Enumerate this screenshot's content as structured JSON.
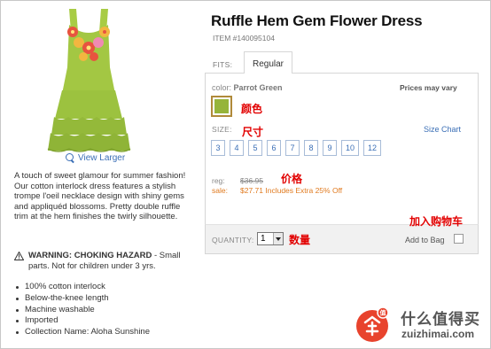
{
  "product": {
    "title": "Ruffle Hem Gem Flower Dress",
    "item_number": "ITEM #140095104",
    "view_larger": "View Larger",
    "description": "A touch of sweet glamour for summer fashion! Our cotton interlock dress features a stylish trompe l'oeil necklace design with shiny gems and appliquéd blossoms. Pretty double ruffle trim at the hem finishes the twirly silhouette.",
    "warning_title": "WARNING: CHOKING HAZARD",
    "warning_text": " - Small parts. Not for children under 3 yrs.",
    "features": [
      "100% cotton interlock",
      "Below-the-knee length",
      "Machine washable",
      "Imported",
      "Collection Name: Aloha Sunshine"
    ]
  },
  "fits": {
    "label": "FITS:",
    "tab": "Regular"
  },
  "color": {
    "label": "color:",
    "value": "Parrot Green",
    "swatch_color": "#96b43a",
    "prices_vary": "Prices may vary"
  },
  "size": {
    "label": "SIZE:",
    "chart_link": "Size Chart",
    "options": [
      "3",
      "4",
      "5",
      "6",
      "7",
      "8",
      "9",
      "10",
      "12"
    ]
  },
  "price": {
    "reg_label": "reg:",
    "reg_value": "$36.95",
    "sale_label": "sale:",
    "sale_value": "$27.71 Includes Extra 25% Off"
  },
  "cart": {
    "quantity_label": "QUANTITY:",
    "quantity_value": "1",
    "add_to_bag": "Add to Bag"
  },
  "annotations": {
    "color": "颜色",
    "size": "尺寸",
    "price": "价格",
    "cart": "加入购物车",
    "quantity": "数量"
  },
  "watermark": {
    "logo_text": "值",
    "cn": "什么值得买",
    "en": "zuizhimai.com"
  },
  "colors": {
    "link": "#3b6fb6",
    "sale": "#e07a1f",
    "annotation": "#e20000",
    "dress": "#9cc23f"
  }
}
